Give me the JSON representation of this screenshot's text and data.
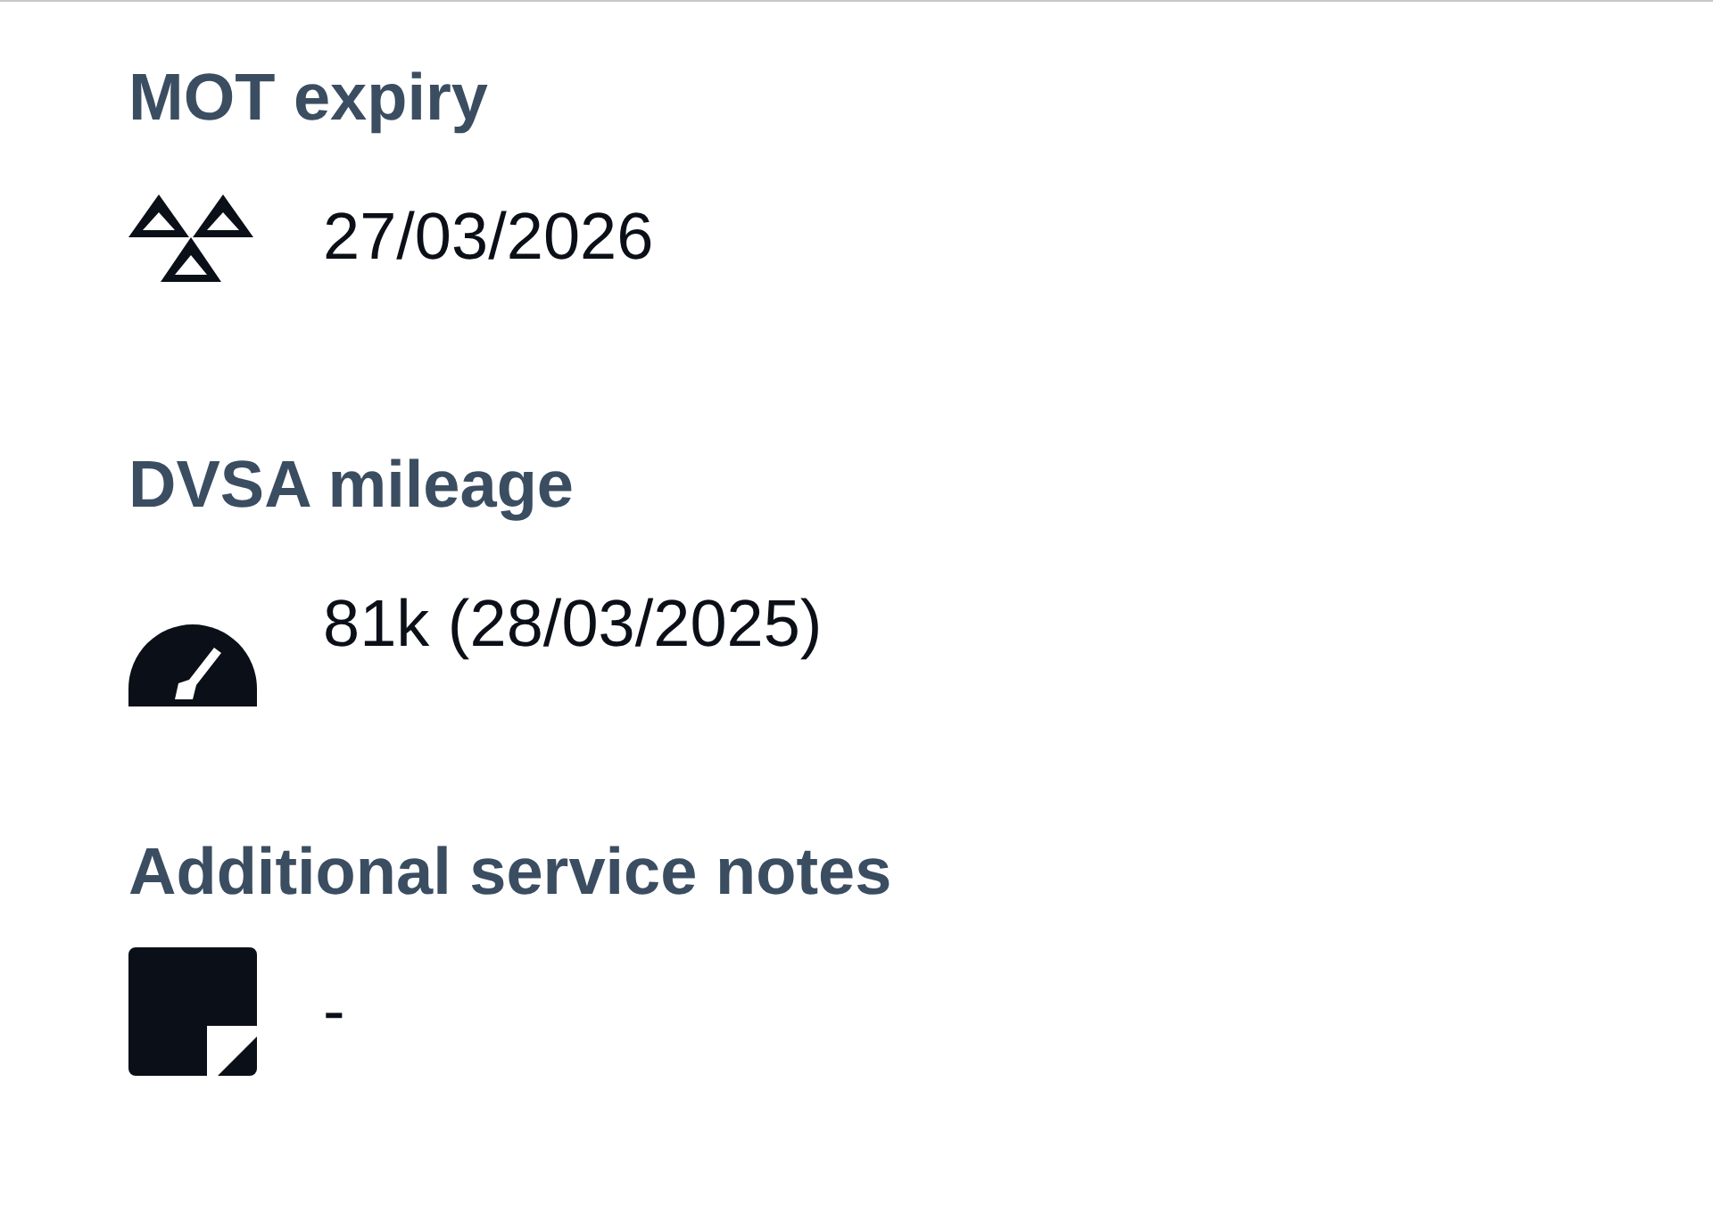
{
  "sections": [
    {
      "heading": "MOT expiry",
      "kind": "mot",
      "value": "27/03/2026"
    },
    {
      "heading": "DVSA mileage",
      "kind": "mileage",
      "value": "81k (28/03/2025)"
    },
    {
      "heading": "Additional service notes",
      "kind": "notes",
      "value": "-"
    }
  ]
}
